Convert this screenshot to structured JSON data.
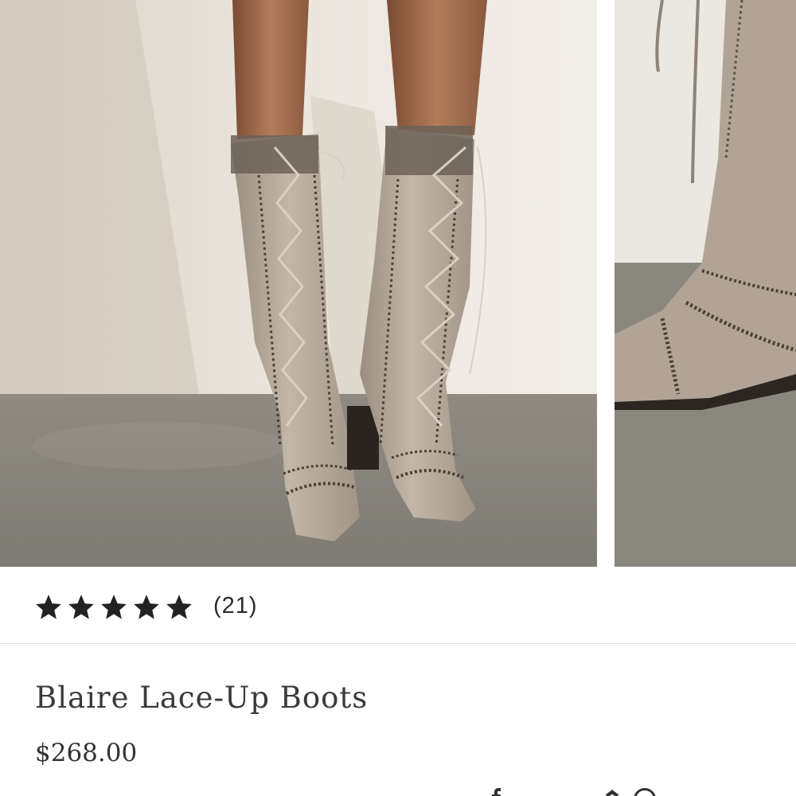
{
  "product": {
    "title": "Blaire Lace-Up Boots",
    "price": "$268.00"
  },
  "rating": {
    "stars": 5,
    "max_stars": 5,
    "review_count_label": "(21)"
  },
  "gallery": {
    "images": [
      {
        "name": "product-image-main"
      },
      {
        "name": "product-image-secondary"
      }
    ]
  },
  "share": {
    "icons": [
      "facebook-icon",
      "pinterest-icon",
      "more-icon"
    ]
  },
  "colors": {
    "text": "#2b2b2b",
    "divider": "#e2e2e2",
    "wall": "#e6e0d6",
    "floor": "#8d8a82",
    "suede": "#b0a396"
  }
}
